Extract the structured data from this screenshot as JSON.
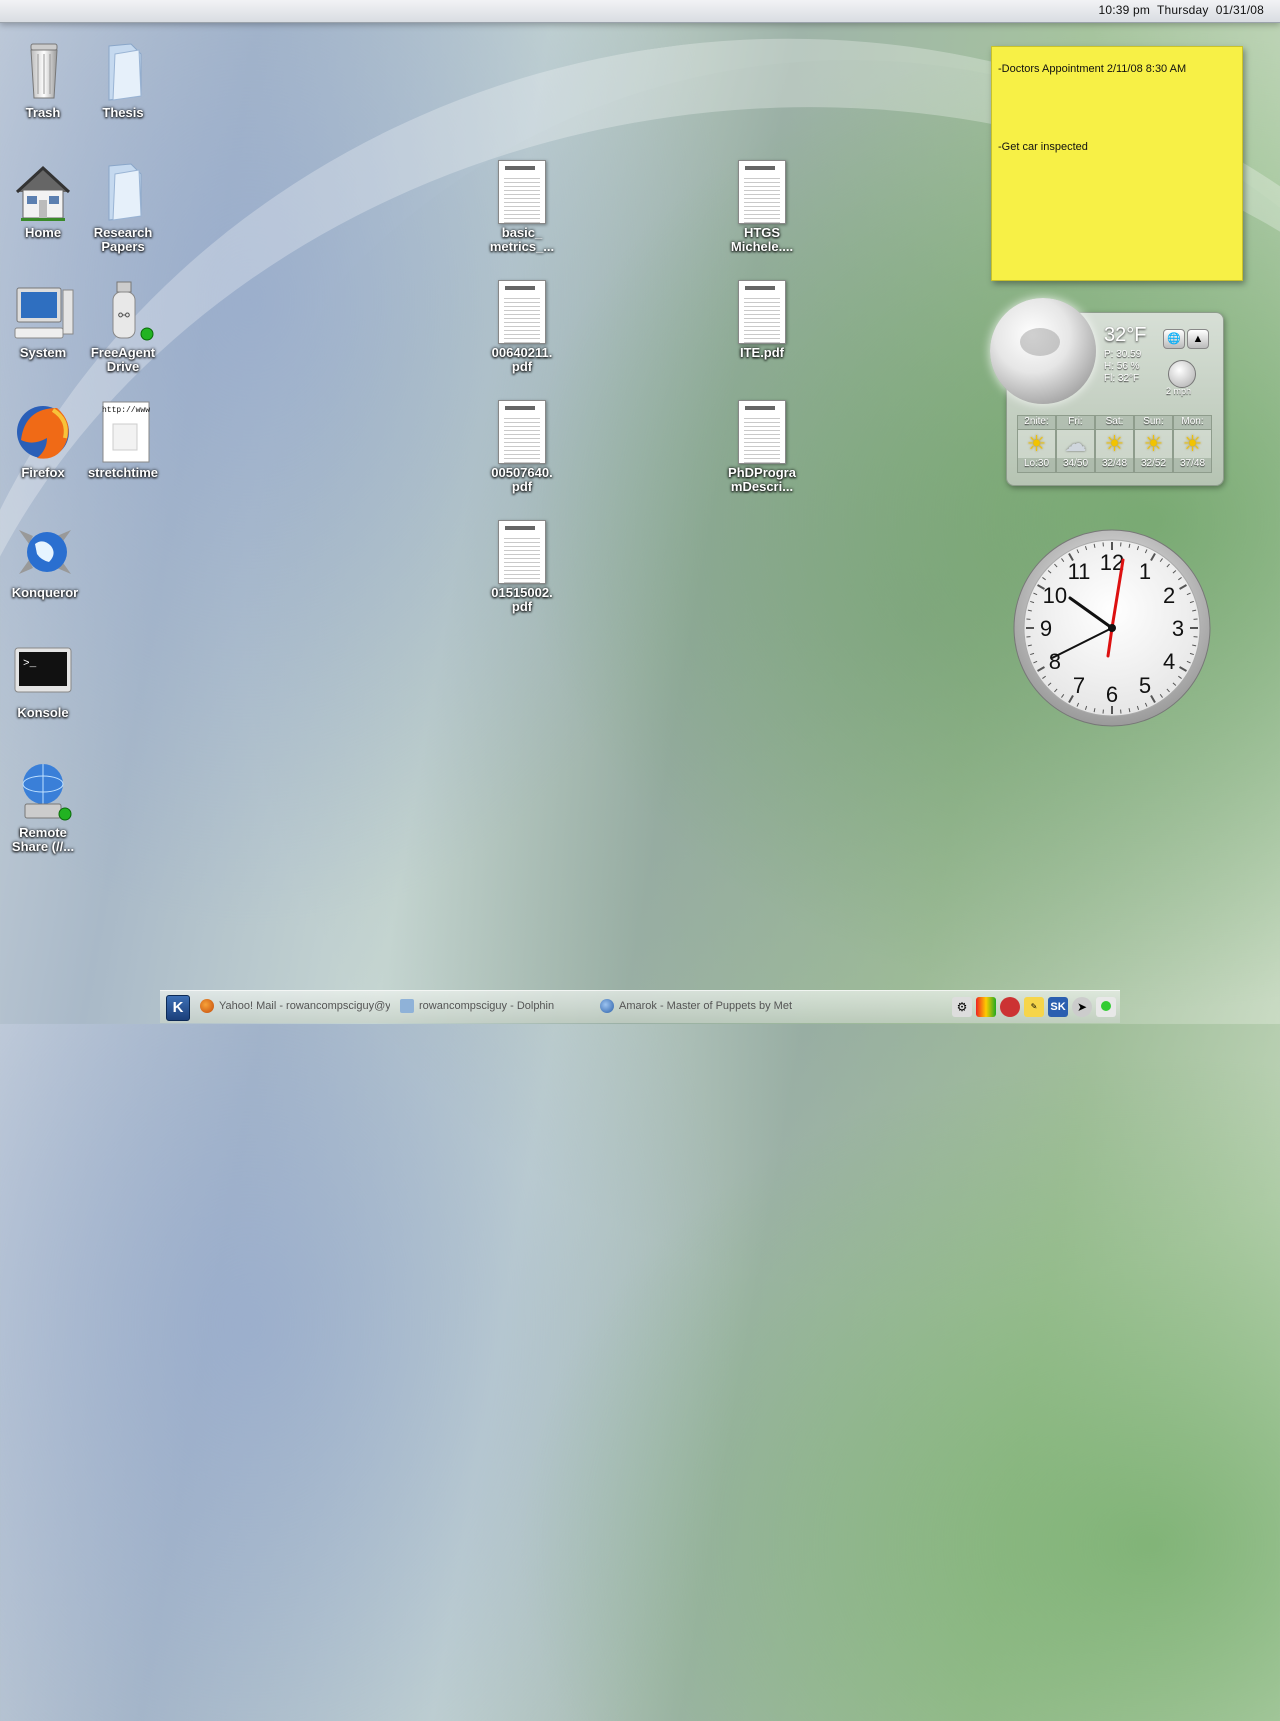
{
  "topbar": {
    "time": "10:39 pm",
    "day": "Thursday",
    "date": "01/31/08"
  },
  "desktop_icons": [
    {
      "label": "Trash",
      "icon": "trash-icon"
    },
    {
      "label": "Thesis",
      "icon": "folder-icon"
    },
    {
      "label": "Home",
      "icon": "home-icon"
    },
    {
      "label": "Research Papers",
      "icon": "folder-icon"
    },
    {
      "label": "System",
      "icon": "computer-icon"
    },
    {
      "label": "FreeAgent Drive",
      "icon": "usb-drive-icon"
    },
    {
      "label": "Firefox",
      "icon": "firefox-icon"
    },
    {
      "label": "stretchtime",
      "icon": "html-file-icon"
    },
    {
      "label": "Konqueror",
      "icon": "konqueror-icon"
    },
    {
      "label": "Konsole",
      "icon": "terminal-icon"
    },
    {
      "label": "Remote Share (//...",
      "icon": "network-share-icon"
    }
  ],
  "files": [
    {
      "label": "basic_ metrics_..."
    },
    {
      "label": "00640211. pdf"
    },
    {
      "label": "00507640. pdf"
    },
    {
      "label": "01515002. pdf"
    },
    {
      "label": "HTGS Michele...."
    },
    {
      "label": "ITE.pdf"
    },
    {
      "label": "PhDProgra mDescri..."
    }
  ],
  "sticky_note": {
    "line1": "-Doctors Appointment 2/11/08 8:30 AM",
    "line2": "-Get car inspected"
  },
  "weather": {
    "temperature": "32°F",
    "pressure": "P: 30.59",
    "humidity": "H: 56 %",
    "feels": "Fl: 32°F",
    "wind": "2 mph",
    "forecast": [
      {
        "day": "2nite:",
        "temps": "Lo:30",
        "icon": "partly-sunny-icon"
      },
      {
        "day": "Fri:",
        "temps": "34/50",
        "icon": "rain-icon"
      },
      {
        "day": "Sat:",
        "temps": "32/48",
        "icon": "sunny-icon"
      },
      {
        "day": "Sun:",
        "temps": "32/52",
        "icon": "partly-sunny-icon"
      },
      {
        "day": "Mon:",
        "temps": "37/48",
        "icon": "partly-sunny-icon"
      }
    ]
  },
  "analog_clock": {
    "numbers": [
      "12",
      "1",
      "2",
      "3",
      "4",
      "5",
      "6",
      "7",
      "8",
      "9",
      "10",
      "11"
    ],
    "time": "10:39"
  },
  "taskbar": {
    "tasks": [
      {
        "label": "Yahoo! Mail - rowancompsciguy@y",
        "icon": "firefox-icon"
      },
      {
        "label": "rowancompsciguy - Dolphin",
        "icon": "dolphin-icon"
      },
      {
        "label": "Amarok - Master of Puppets by Met",
        "icon": "amarok-icon"
      }
    ],
    "kmenu_label": "K"
  },
  "colors": {
    "sticky": "#f7f046",
    "label_text": "#ffffff"
  }
}
